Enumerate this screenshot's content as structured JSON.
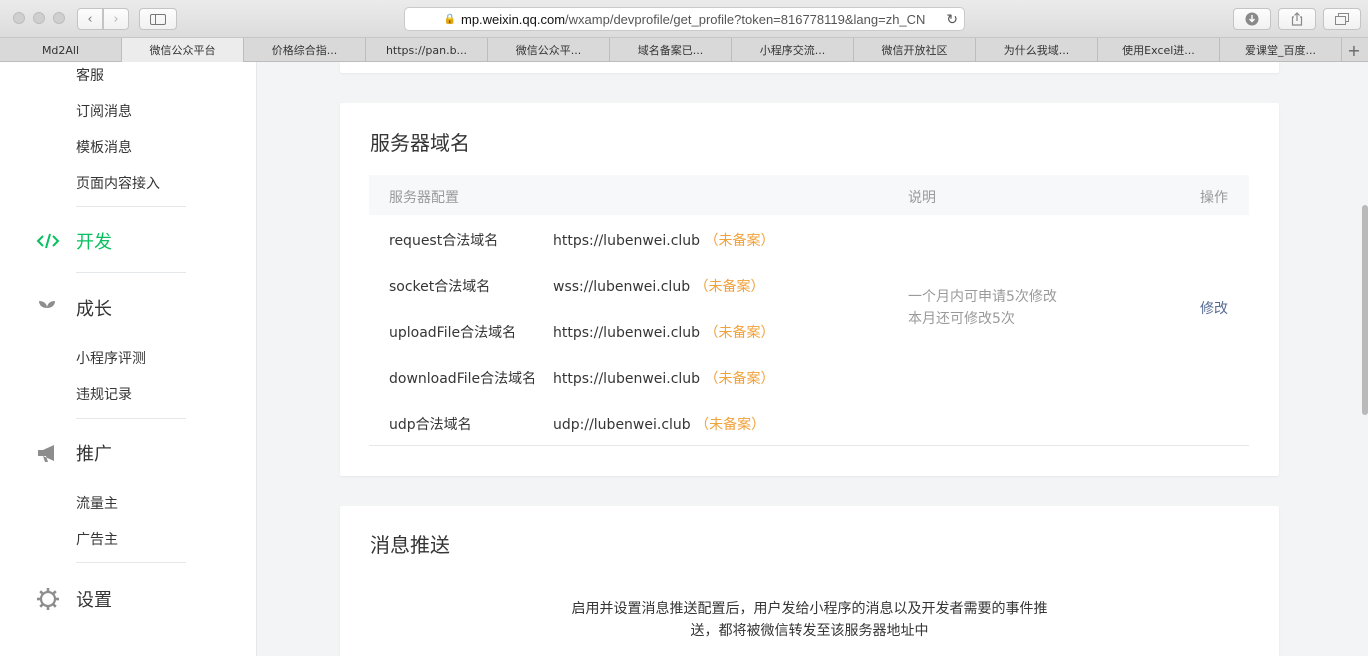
{
  "browser": {
    "url_host": "mp.weixin.qq.com",
    "url_path": "/wxamp/devprofile/get_profile?token=816778119&lang=zh_CN",
    "tabs": [
      "Md2All",
      "微信公众平台",
      "价格综合指...",
      "https://pan.b...",
      "微信公众平...",
      "域名备案已...",
      "小程序交流...",
      "微信开放社区",
      "为什么我域...",
      "使用Excel进...",
      "爱课堂_百度..."
    ]
  },
  "sidebar": {
    "top_items": [
      "客服",
      "订阅消息",
      "模板消息",
      "页面内容接入"
    ],
    "dev_label": "开发",
    "growth_label": "成长",
    "growth_items": [
      "小程序评测",
      "违规记录"
    ],
    "promo_label": "推广",
    "promo_items": [
      "流量主",
      "广告主"
    ],
    "settings_label": "设置"
  },
  "server_domain": {
    "title": "服务器域名",
    "col_config": "服务器配置",
    "col_desc": "说明",
    "col_action": "操作",
    "rows": [
      {
        "label": "request合法域名",
        "value": "https://lubenwei.club",
        "tag": "（未备案）"
      },
      {
        "label": "socket合法域名",
        "value": "wss://lubenwei.club",
        "tag": "（未备案）"
      },
      {
        "label": "uploadFile合法域名",
        "value": "https://lubenwei.club",
        "tag": "（未备案）"
      },
      {
        "label": "downloadFile合法域名",
        "value": "https://lubenwei.club",
        "tag": "（未备案）"
      },
      {
        "label": "udp合法域名",
        "value": "udp://lubenwei.club",
        "tag": "（未备案）"
      }
    ],
    "desc_line1": "一个月内可申请5次修改",
    "desc_line2": "本月还可修改5次",
    "modify": "修改"
  },
  "message_push": {
    "title": "消息推送",
    "line1": "启用并设置消息推送配置后，用户发给小程序的消息以及开发者需要的事件推",
    "line2": "送，都将被微信转发至该服务器地址中"
  },
  "colors": {
    "accent_green": "#07c160",
    "tag_orange": "#f0a23b",
    "link_blue": "#576b95"
  }
}
